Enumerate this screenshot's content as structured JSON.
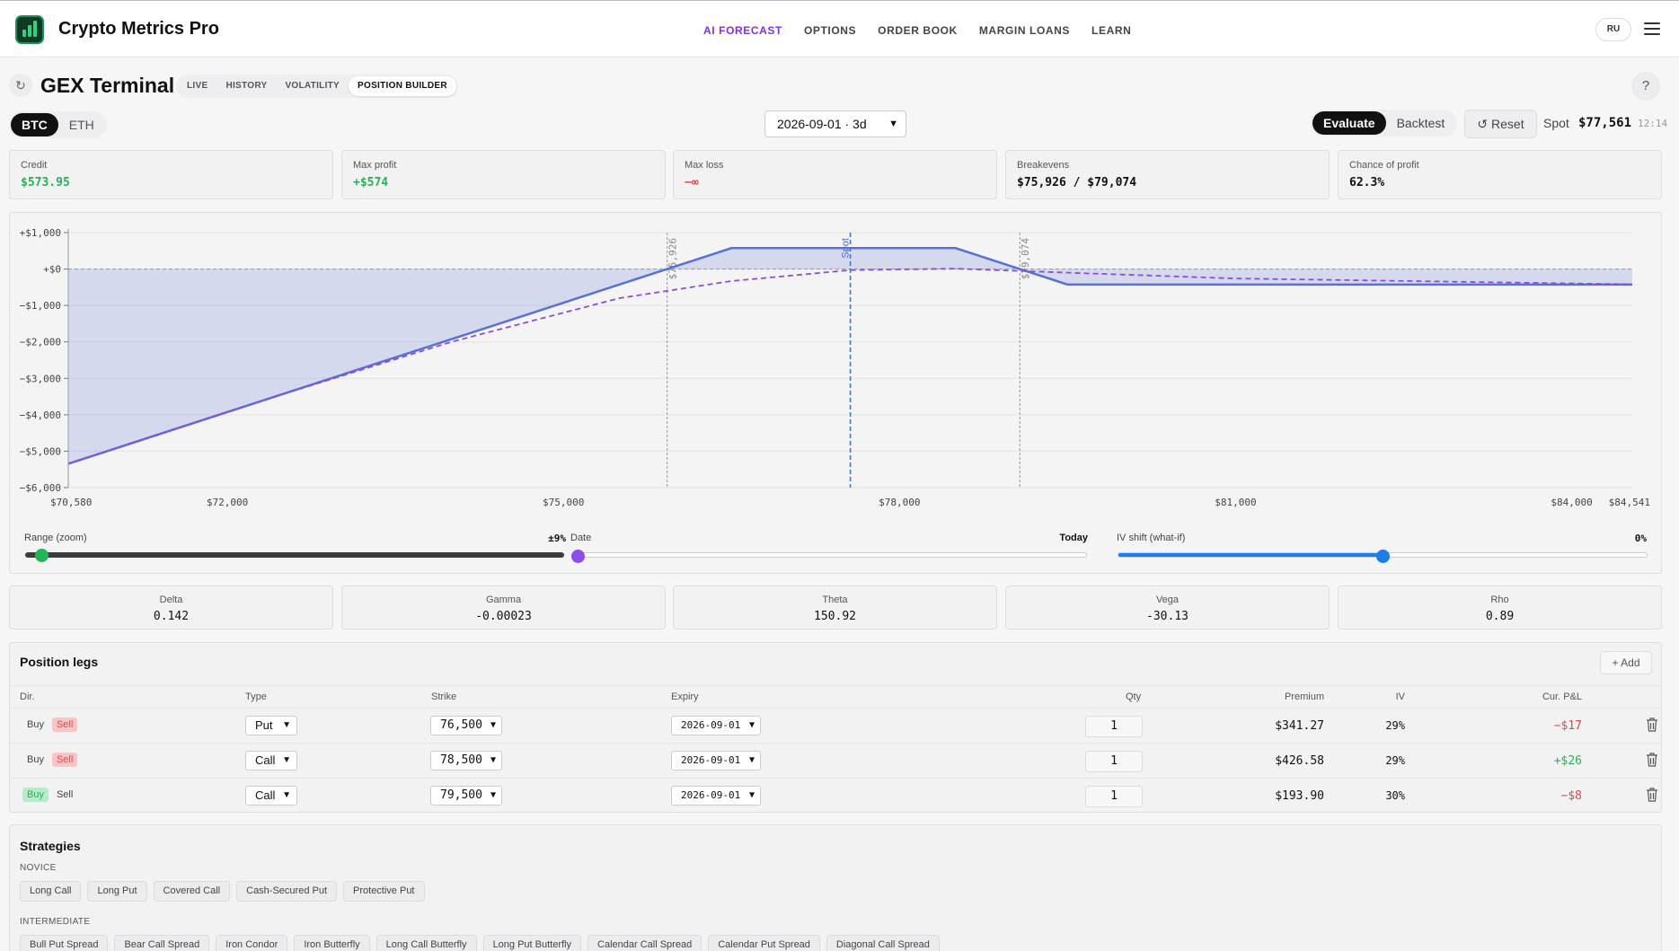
{
  "app": {
    "brand": "Crypto Metrics Pro",
    "lang": "RU"
  },
  "nav": [
    "AI FORECAST",
    "OPTIONS",
    "ORDER BOOK",
    "MARGIN LOANS",
    "LEARN"
  ],
  "page": {
    "title": "GEX Terminal",
    "tabs": [
      "LIVE",
      "HISTORY",
      "VOLATILITY",
      "POSITION BUILDER"
    ],
    "active_tab": "POSITION BUILDER"
  },
  "controls": {
    "assets": [
      "BTC",
      "ETH"
    ],
    "active_asset": "BTC",
    "expiry": "2026-09-01 · 3d",
    "modes": [
      "Evaluate",
      "Backtest"
    ],
    "active_mode": "Evaluate",
    "reset_label": "Reset",
    "spot_label": "Spot",
    "spot_value": "$77,561",
    "spot_time": "12:14"
  },
  "metrics": [
    {
      "label": "Credit",
      "value": "$573.95",
      "tone": "green"
    },
    {
      "label": "Max profit",
      "value": "+$574",
      "tone": "green"
    },
    {
      "label": "Max loss",
      "value": "−∞",
      "tone": "red"
    },
    {
      "label": "Breakevens",
      "value": "$75,926 / $79,074",
      "tone": "dark"
    },
    {
      "label": "Chance of profit",
      "value": "62.3%",
      "tone": "dark"
    }
  ],
  "chart_data": {
    "type": "line",
    "xlim": [
      70580,
      84541
    ],
    "ylim": [
      -6000,
      1000
    ],
    "x_tick_labels": [
      "$70,580",
      "$72,000",
      "$75,000",
      "$78,000",
      "$81,000",
      "$84,000",
      "$84,541"
    ],
    "x_ticks": [
      70580,
      72000,
      75000,
      78000,
      81000,
      84000,
      84541
    ],
    "y_tick_labels": [
      "+$1,000",
      "+$0",
      "−$1,000",
      "−$2,000",
      "−$3,000",
      "−$4,000",
      "−$5,000",
      "−$6,000"
    ],
    "y_ticks": [
      1000,
      0,
      -1000,
      -2000,
      -3000,
      -4000,
      -5000,
      -6000
    ],
    "spot": {
      "x": 77561,
      "label": "Spot"
    },
    "breakevens": [
      {
        "x": 75926,
        "label": "$75,926"
      },
      {
        "x": 79074,
        "label": "$79,074"
      }
    ],
    "series": [
      {
        "style": "solid",
        "color": "#5a6fd8",
        "fill": true,
        "x": [
          70580,
          76500,
          78500,
          79500,
          84541
        ],
        "y": [
          -5346,
          574,
          574,
          -426,
          -426
        ]
      },
      {
        "style": "dashed",
        "color": "#8a4fd8",
        "x": [
          70580,
          72500,
          74000,
          75500,
          76500,
          77561,
          78500,
          79500,
          81000,
          84541
        ],
        "y": [
          -5346,
          -3430,
          -2000,
          -800,
          -330,
          -30,
          10,
          -100,
          -260,
          -420
        ]
      }
    ]
  },
  "sliders": [
    {
      "label": "Range (zoom)",
      "value": "±9%",
      "fraction": 0.03
    },
    {
      "label": "Date",
      "value": "Today",
      "fraction": 0.0
    },
    {
      "label": "IV shift (what-if)",
      "value": "0%",
      "fraction": 0.5
    }
  ],
  "greeks": [
    {
      "label": "Delta",
      "value": "0.142"
    },
    {
      "label": "Gamma",
      "value": "-0.00023"
    },
    {
      "label": "Theta",
      "value": "150.92"
    },
    {
      "label": "Vega",
      "value": "-30.13"
    },
    {
      "label": "Rho",
      "value": "0.89"
    }
  ],
  "legs": {
    "title": "Position legs",
    "add_label": "Add",
    "headers": {
      "dir": "Dir.",
      "type": "Type",
      "strike": "Strike",
      "expiry": "Expiry",
      "qty": "Qty",
      "premium": "Premium",
      "iv": "IV",
      "pnl": "Cur. P&L"
    },
    "buy_label": "Buy",
    "sell_label": "Sell",
    "rows": [
      {
        "dir": "Sell",
        "type": "Put",
        "strike": "76,500",
        "expiry": "2026-09-01",
        "qty": "1",
        "premium": "$341.27",
        "iv": "29%",
        "pnl": "−$17",
        "pnl_tone": "red"
      },
      {
        "dir": "Sell",
        "type": "Call",
        "strike": "78,500",
        "expiry": "2026-09-01",
        "qty": "1",
        "premium": "$426.58",
        "iv": "29%",
        "pnl": "+$26",
        "pnl_tone": "green"
      },
      {
        "dir": "Buy",
        "type": "Call",
        "strike": "79,500",
        "expiry": "2026-09-01",
        "qty": "1",
        "premium": "$193.90",
        "iv": "30%",
        "pnl": "−$8",
        "pnl_tone": "red"
      }
    ]
  },
  "strategies": {
    "title": "Strategies",
    "groups": [
      {
        "name": "NOVICE",
        "items": [
          "Long Call",
          "Long Put",
          "Covered Call",
          "Cash-Secured Put",
          "Protective Put"
        ]
      },
      {
        "name": "INTERMEDIATE",
        "items": [
          "Bull Put Spread",
          "Bear Call Spread",
          "Iron Condor",
          "Iron Butterfly",
          "Long Call Butterfly",
          "Long Put Butterfly",
          "Calendar Call Spread",
          "Calendar Put Spread",
          "Diagonal Call Spread"
        ]
      }
    ]
  }
}
